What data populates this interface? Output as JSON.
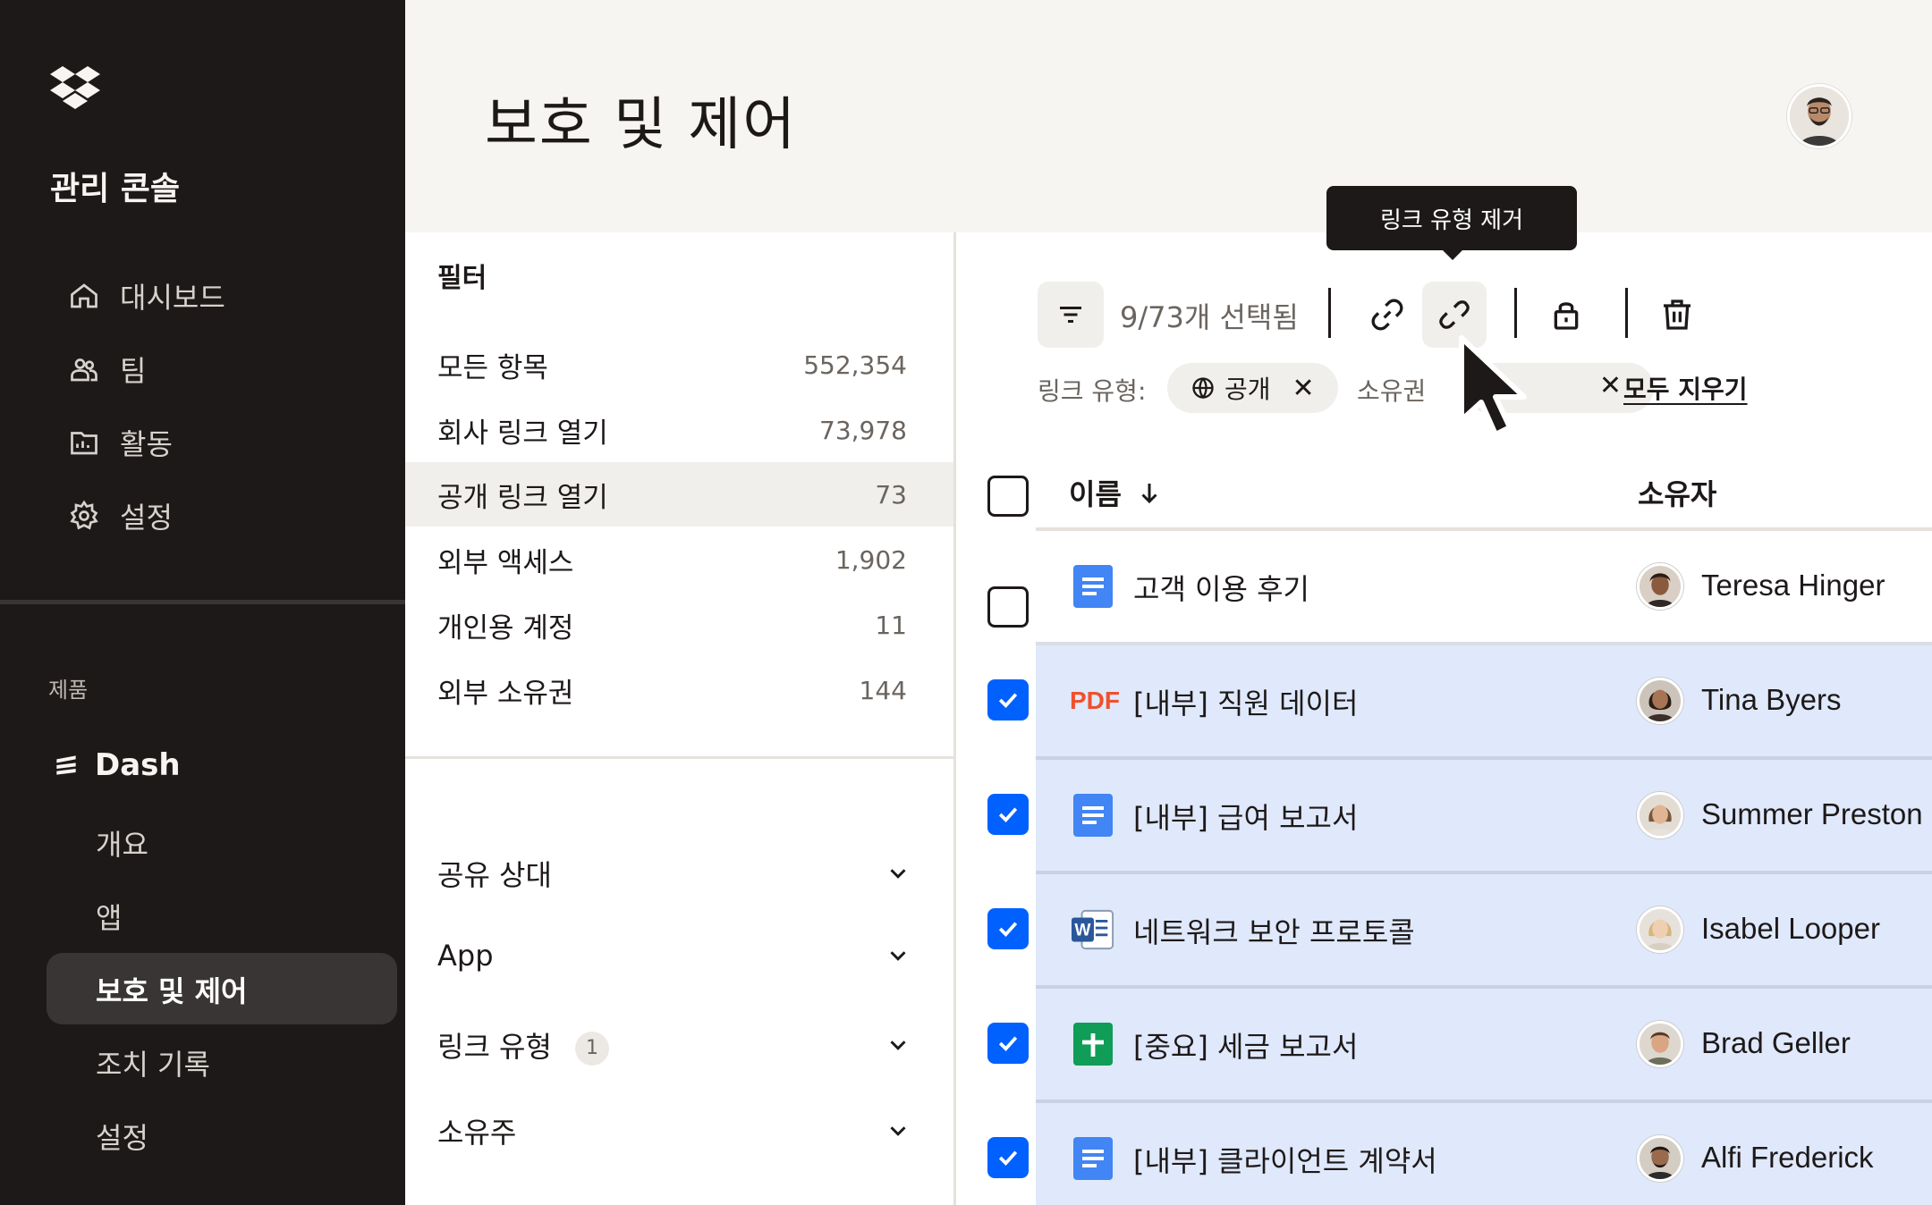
{
  "sidebar": {
    "title": "관리 콘솔",
    "nav": [
      {
        "label": "대시보드",
        "icon": "home-icon"
      },
      {
        "label": "팀",
        "icon": "team-icon"
      },
      {
        "label": "활동",
        "icon": "activity-icon"
      },
      {
        "label": "설정",
        "icon": "gear-icon"
      }
    ],
    "section_label": "제품",
    "product": "Dash",
    "sub_items": [
      {
        "label": "개요"
      },
      {
        "label": "앱"
      },
      {
        "label": "보호 및 제어",
        "active": true
      },
      {
        "label": "조치 기록"
      },
      {
        "label": "설정"
      }
    ]
  },
  "header": {
    "title": "보호 및 제어"
  },
  "filters": {
    "title": "필터",
    "rows": [
      {
        "label": "모든 항목",
        "count": "552,354"
      },
      {
        "label": "회사 링크 열기",
        "count": "73,978"
      },
      {
        "label": "공개 링크 열기",
        "count": "73",
        "selected": true
      },
      {
        "label": "외부 액세스",
        "count": "1,902"
      },
      {
        "label": "개인용 계정",
        "count": "11"
      },
      {
        "label": "외부 소유권",
        "count": "144"
      }
    ],
    "groups": [
      {
        "label": "공유 상대"
      },
      {
        "label": "App"
      },
      {
        "label": "링크 유형",
        "badge": "1"
      },
      {
        "label": "소유주"
      }
    ]
  },
  "toolbar": {
    "selected_count": "9/73개 선택됨",
    "tooltip": "링크 유형 제거",
    "chip_label": "링크 유형:",
    "chip_value": "공개",
    "chip2_label": "소유권",
    "clear_all": "모두 지우기"
  },
  "table": {
    "col_name": "이름",
    "col_owner": "소유자",
    "rows": [
      {
        "name": "고객 이용 후기",
        "type": "doc",
        "owner": "Teresa Hinger",
        "checked": false
      },
      {
        "name": "[내부] 직원 데이터",
        "type": "pdf",
        "type_label": "PDF",
        "owner": "Tina Byers",
        "checked": true
      },
      {
        "name": "[내부] 급여 보고서",
        "type": "doc",
        "owner": "Summer Preston",
        "checked": true
      },
      {
        "name": "네트워크 보안 프로토콜",
        "type": "word",
        "owner": "Isabel Looper",
        "checked": true
      },
      {
        "name": "[중요] 세금 보고서",
        "type": "sheet",
        "owner": "Brad Geller",
        "checked": true
      },
      {
        "name": "[내부] 클라이언트 계약서",
        "type": "doc",
        "owner": "Alfi Frederick",
        "checked": true
      }
    ]
  },
  "colors": {
    "sidebar_bg": "#1e1919",
    "accent_blue": "#0061fe",
    "selected_row": "#dfe9fb",
    "pdf_red": "#f0502d",
    "doc_blue": "#4285f4",
    "sheet_green": "#0f9d58"
  }
}
